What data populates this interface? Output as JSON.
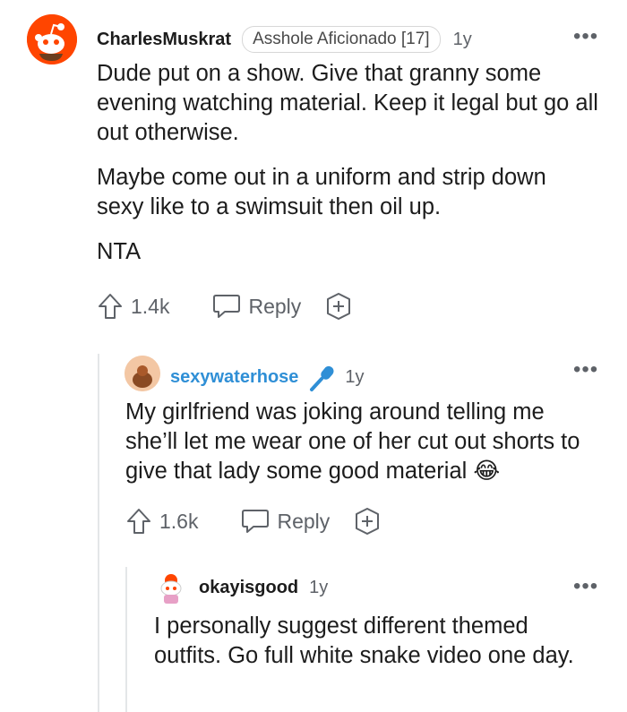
{
  "comments": [
    {
      "username": "CharlesMuskrat",
      "flair": "Asshole Aficionado [17]",
      "time": "1y",
      "paragraphs": [
        "Dude put on a show. Give that granny some evening watching material. Keep it legal but go all out otherwise.",
        "Maybe come out in a uniform and strip down sexy like to a swimsuit then oil up.",
        "NTA"
      ],
      "score": "1.4k",
      "reply_label": "Reply"
    },
    {
      "username": "sexywaterhose",
      "time": "1y",
      "text": "My girlfriend was joking around telling me she’ll let me wear one of her cut out shorts to give that lady some good material",
      "emoji": "😂",
      "score": "1.6k",
      "reply_label": "Reply"
    },
    {
      "username": "okayisgood",
      "time": "1y",
      "text": "I personally suggest different themed outfits. Go full white snake video one day."
    }
  ],
  "colors": {
    "accent_blue": "#2f8fd6",
    "reddit_orange": "#ff4500"
  },
  "icons": [
    "snoo-avatar-icon",
    "microphone-icon",
    "more-options-icon",
    "upvote-arrow-icon",
    "comment-bubble-icon",
    "add-award-icon"
  ]
}
